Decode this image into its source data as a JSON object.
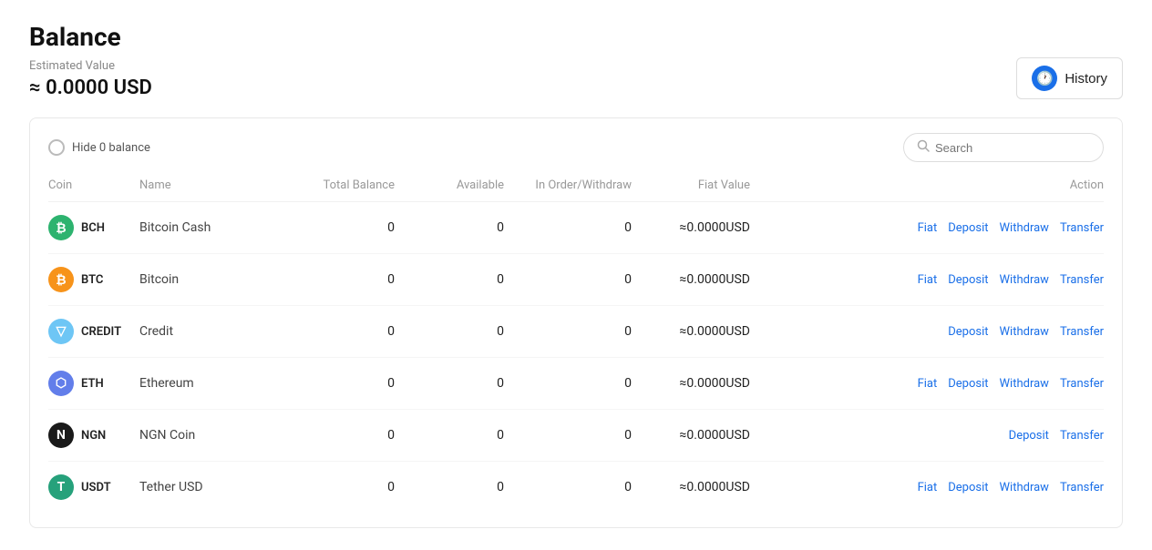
{
  "page": {
    "title": "Balance",
    "estimated_label": "Estimated Value",
    "estimated_value": "≈ 0.0000 USD"
  },
  "history_button": {
    "label": "History",
    "icon": "🕐"
  },
  "toolbar": {
    "hide_balance_label": "Hide 0 balance",
    "search_placeholder": "Search"
  },
  "table": {
    "columns": {
      "coin": "Coin",
      "name": "Name",
      "total_balance": "Total Balance",
      "available": "Available",
      "in_order": "In Order/Withdraw",
      "fiat_value": "Fiat Value",
      "action": "Action"
    },
    "rows": [
      {
        "ticker": "BCH",
        "name": "Bitcoin Cash",
        "total_balance": "0",
        "available": "0",
        "in_order": "0",
        "fiat_value": "≈0.0000USD",
        "icon_color": "#2db36f",
        "icon_letter": "₿",
        "actions": [
          "Fiat",
          "Deposit",
          "Withdraw",
          "Transfer"
        ]
      },
      {
        "ticker": "BTC",
        "name": "Bitcoin",
        "total_balance": "0",
        "available": "0",
        "in_order": "0",
        "fiat_value": "≈0.0000USD",
        "icon_color": "#f7931a",
        "icon_letter": "₿",
        "actions": [
          "Fiat",
          "Deposit",
          "Withdraw",
          "Transfer"
        ]
      },
      {
        "ticker": "CREDIT",
        "name": "Credit",
        "total_balance": "0",
        "available": "0",
        "in_order": "0",
        "fiat_value": "≈0.0000USD",
        "icon_color": "#6ec6f5",
        "icon_letter": "▽",
        "actions": [
          "Deposit",
          "Withdraw",
          "Transfer"
        ]
      },
      {
        "ticker": "ETH",
        "name": "Ethereum",
        "total_balance": "0",
        "available": "0",
        "in_order": "0",
        "fiat_value": "≈0.0000USD",
        "icon_color": "#627eea",
        "icon_letter": "⬡",
        "actions": [
          "Fiat",
          "Deposit",
          "Withdraw",
          "Transfer"
        ]
      },
      {
        "ticker": "NGN",
        "name": "NGN Coin",
        "total_balance": "0",
        "available": "0",
        "in_order": "0",
        "fiat_value": "≈0.0000USD",
        "icon_color": "#1a1a1a",
        "icon_letter": "N",
        "actions": [
          "Deposit",
          "Transfer"
        ]
      },
      {
        "ticker": "USDT",
        "name": "Tether USD",
        "total_balance": "0",
        "available": "0",
        "in_order": "0",
        "fiat_value": "≈0.0000USD",
        "icon_color": "#26a17b",
        "icon_letter": "T",
        "actions": [
          "Fiat",
          "Deposit",
          "Withdraw",
          "Transfer"
        ]
      }
    ]
  }
}
